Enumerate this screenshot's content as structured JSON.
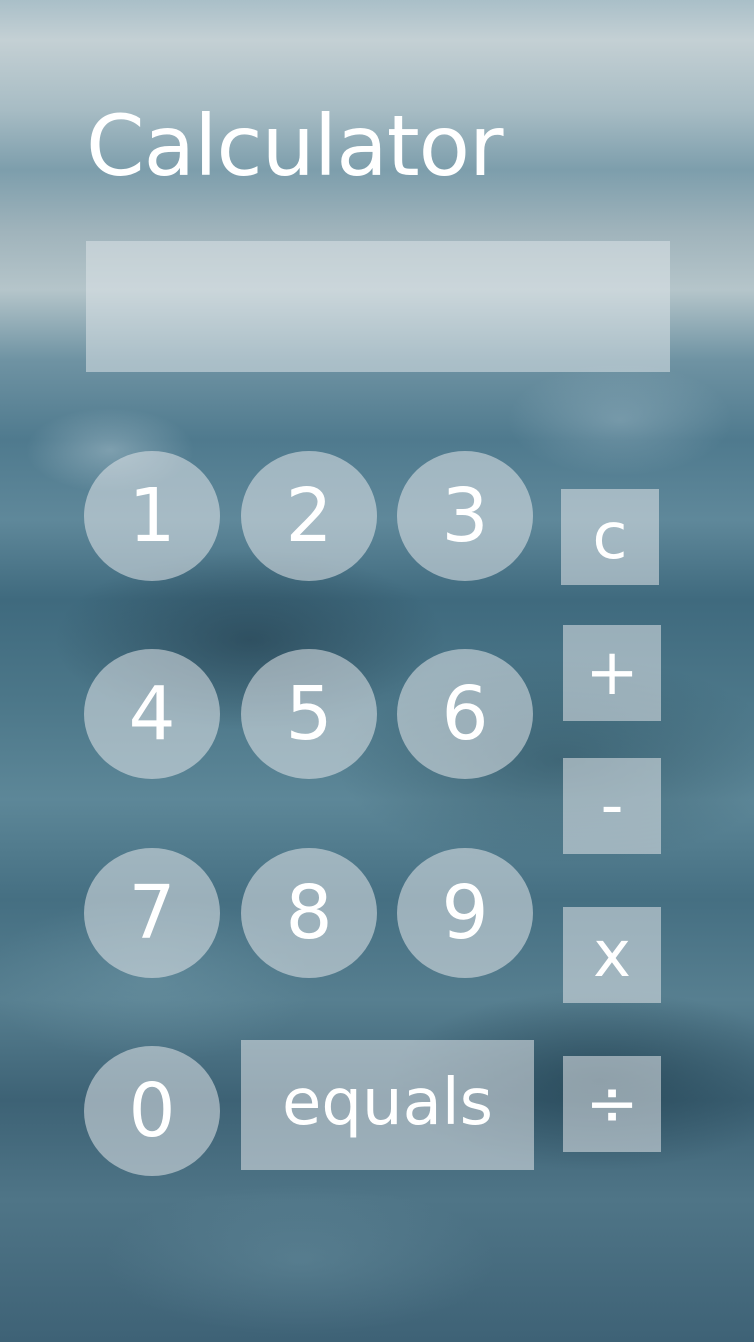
{
  "app": {
    "title": "Calculator"
  },
  "display": {
    "value": ""
  },
  "keys": {
    "digits": [
      "1",
      "2",
      "3",
      "4",
      "5",
      "6",
      "7",
      "8",
      "9",
      "0"
    ],
    "clear": "c",
    "add": "+",
    "subtract": "-",
    "multiply": "x",
    "divide": "÷",
    "equals": "equals"
  },
  "colors": {
    "text": "#ffffff",
    "button_fill": "rgba(225,230,233,0.55)",
    "display_fill": "rgba(220,228,232,0.55)"
  }
}
